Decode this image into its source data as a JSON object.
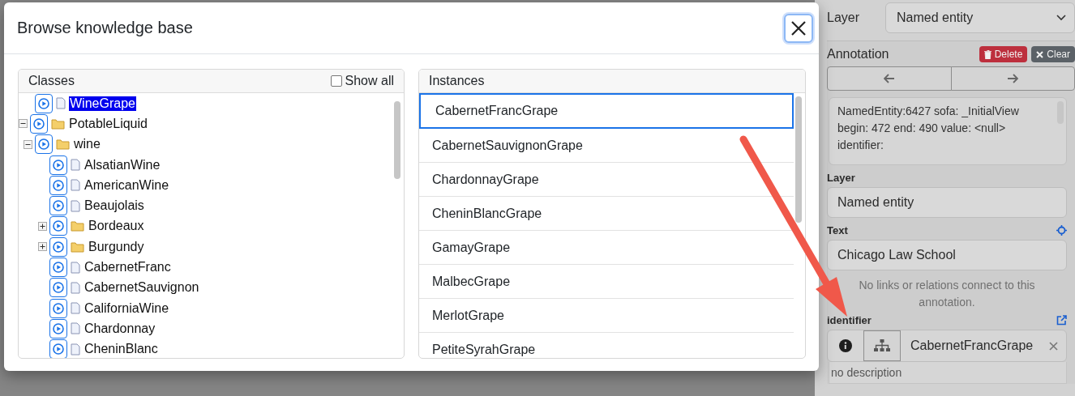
{
  "dialog": {
    "title": "Browse knowledge base",
    "classes": {
      "title": "Classes",
      "show_all": {
        "label": "Show all",
        "checked": false
      },
      "tree": [
        {
          "children": [
            {
              "label": "WineGrape",
              "kind": "leaf",
              "selected": true
            }
          ]
        },
        {
          "label": "PotableLiquid",
          "kind": "folder",
          "expanded": true,
          "selected": false,
          "children": [
            {
              "label": "wine",
              "kind": "folder",
              "expanded": true,
              "selected": false,
              "children": [
                {
                  "label": "AlsatianWine",
                  "kind": "leaf",
                  "selected": false
                },
                {
                  "label": "AmericanWine",
                  "kind": "leaf",
                  "selected": false
                },
                {
                  "label": "Beaujolais",
                  "kind": "leaf",
                  "selected": false
                },
                {
                  "label": "Bordeaux",
                  "kind": "folder",
                  "expanded": false,
                  "selected": false
                },
                {
                  "label": "Burgundy",
                  "kind": "folder",
                  "expanded": false,
                  "selected": false
                },
                {
                  "label": "CabernetFranc",
                  "kind": "leaf",
                  "selected": false
                },
                {
                  "label": "CabernetSauvignon",
                  "kind": "leaf",
                  "selected": false
                },
                {
                  "label": "CaliforniaWine",
                  "kind": "leaf",
                  "selected": false
                },
                {
                  "label": "Chardonnay",
                  "kind": "leaf",
                  "selected": false
                },
                {
                  "label": "CheninBlanc",
                  "kind": "leaf",
                  "selected": false
                }
              ]
            }
          ]
        }
      ]
    },
    "instances": {
      "title": "Instances",
      "items": [
        {
          "label": "CabernetFrancGrape",
          "selected": true
        },
        {
          "label": "CabernetSauvignonGrape",
          "selected": false
        },
        {
          "label": "ChardonnayGrape",
          "selected": false
        },
        {
          "label": "CheninBlancGrape",
          "selected": false
        },
        {
          "label": "GamayGrape",
          "selected": false
        },
        {
          "label": "MalbecGrape",
          "selected": false
        },
        {
          "label": "MerlotGrape",
          "selected": false
        },
        {
          "label": "PetiteSyrahGrape",
          "selected": false
        }
      ]
    }
  },
  "side_panel": {
    "layer_select": {
      "label": "Layer",
      "value": "Named entity"
    },
    "annotation": {
      "title": "Annotation",
      "buttons": [
        {
          "label": "Delete",
          "kind": "danger"
        },
        {
          "label": "Clear",
          "kind": "secondary"
        }
      ],
      "details": [
        "NamedEntity:6427 sofa: _InitialView",
        "begin: 472 end: 490 value: <null>",
        "identifier:"
      ]
    },
    "layer": {
      "label": "Layer",
      "value": "Named entity"
    },
    "text": {
      "label": "Text",
      "value": "Chicago Law School"
    },
    "note": "No links or relations connect to this annotation.",
    "identifier": {
      "label": "identifier",
      "value": "CabernetFrancGrape",
      "description": "no description"
    }
  }
}
